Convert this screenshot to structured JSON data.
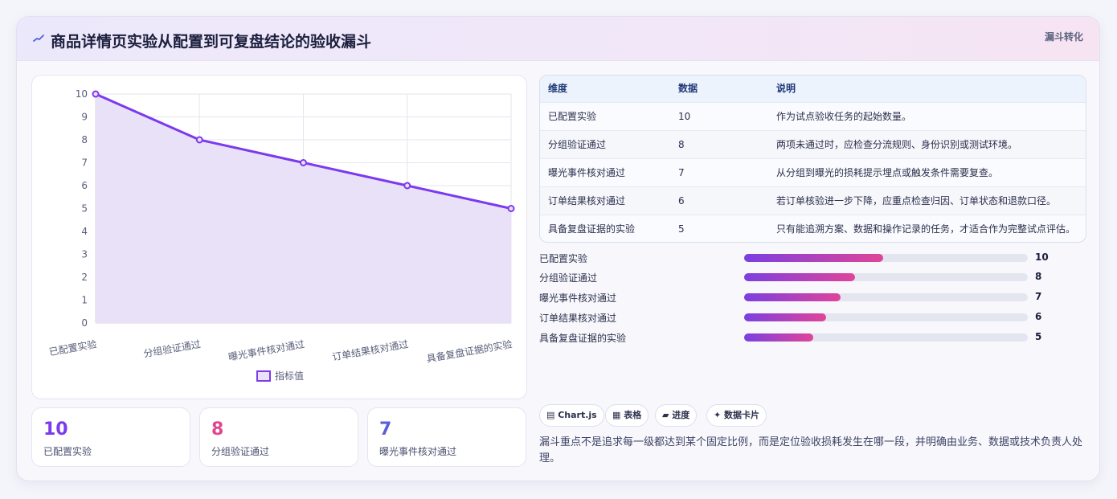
{
  "header": {
    "title": "商品详情页实验从配置到可复盘结论的验收漏斗",
    "tag": "漏斗转化"
  },
  "chart_data": {
    "type": "area",
    "categories": [
      "已配置实验",
      "分组验证通过",
      "曝光事件核对通过",
      "订单结果核对通过",
      "具备复盘证据的实验"
    ],
    "series": [
      {
        "name": "指标值",
        "values": [
          10,
          8,
          7,
          6,
          5
        ]
      }
    ],
    "ylim": [
      0,
      10
    ],
    "yticks": [
      0,
      1,
      2,
      3,
      4,
      5,
      6,
      7,
      8,
      9,
      10
    ],
    "grid": true,
    "legend": "bottom",
    "line_color": "#7c3aed",
    "fill_color": "#e9e1f8"
  },
  "stats": [
    {
      "value": "10",
      "label": "已配置实验",
      "color": "#7c3aed"
    },
    {
      "value": "8",
      "label": "分组验证通过",
      "color": "#e0468f"
    },
    {
      "value": "7",
      "label": "曝光事件核对通过",
      "color": "#5b5fd8"
    }
  ],
  "table": {
    "headers": [
      "维度",
      "数据",
      "说明"
    ],
    "rows": [
      [
        "已配置实验",
        "10",
        "作为试点验收任务的起始数量。"
      ],
      [
        "分组验证通过",
        "8",
        "两项未通过时，应检查分流规则、身份识别或测试环境。"
      ],
      [
        "曝光事件核对通过",
        "7",
        "从分组到曝光的损耗提示埋点或触发条件需要复查。"
      ],
      [
        "订单结果核对通过",
        "6",
        "若订单核验进一步下降，应重点检查归因、订单状态和退款口径。"
      ],
      [
        "具备复盘证据的实验",
        "5",
        "只有能追溯方案、数据和操作记录的任务，才适合作为完整试点评估。"
      ]
    ]
  },
  "progress": [
    {
      "label": "已配置实验",
      "value": 10,
      "fraction": 0.49
    },
    {
      "label": "分组验证通过",
      "value": 8,
      "fraction": 0.39
    },
    {
      "label": "曝光事件核对通过",
      "value": 7,
      "fraction": 0.34
    },
    {
      "label": "订单结果核对通过",
      "value": 6,
      "fraction": 0.29
    },
    {
      "label": "具备复盘证据的实验",
      "value": 5,
      "fraction": 0.245
    }
  ],
  "chips": [
    "▤ Chart.js",
    "▦ 表格",
    "▰ 进度",
    "✦ 数据卡片"
  ],
  "note": "漏斗重点不是追求每一级都达到某个固定比例，而是定位验收损耗发生在哪一段，并明确由业务、数据或技术负责人处理。"
}
